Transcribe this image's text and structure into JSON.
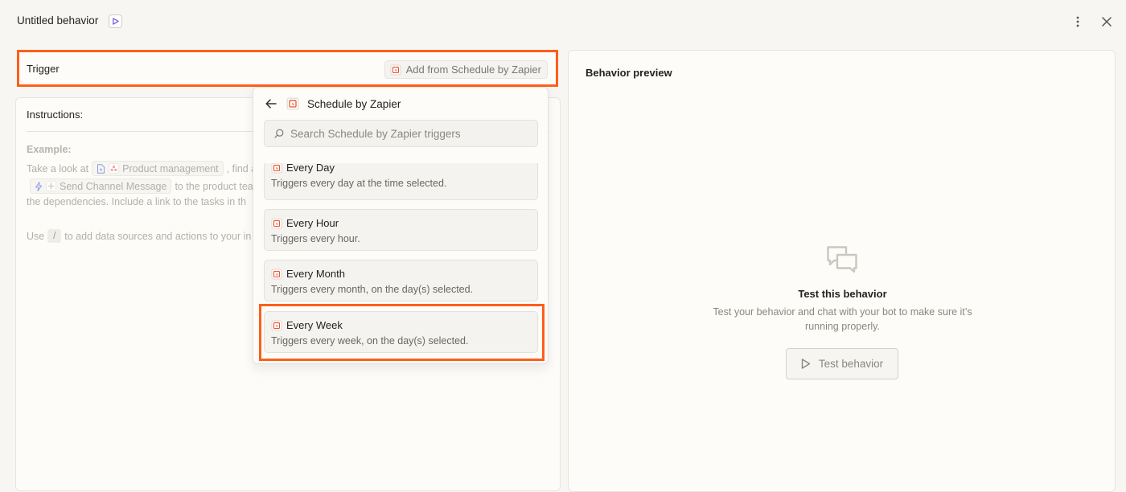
{
  "header": {
    "title": "Untitled behavior"
  },
  "trigger": {
    "label": "Trigger",
    "add_button_label": "Add from Schedule by Zapier"
  },
  "instructions": {
    "label": "Instructions:",
    "example_label": "Example:",
    "line1_prefix": "Take a look at",
    "chip_product": "Product management",
    "line1_suffix": ", find a",
    "chip_send": "Send Channel Message",
    "line2_suffix": "to the product tea",
    "line3": "the dependencies. Include a link to the tasks in th",
    "line4_prefix": "Use",
    "slash": "/",
    "line4_suffix": "to add data sources and actions to your in"
  },
  "dropdown": {
    "title": "Schedule by Zapier",
    "search_placeholder": "Search Schedule by Zapier triggers",
    "items": [
      {
        "name": "Every Day",
        "desc": "Triggers every day at the time selected."
      },
      {
        "name": "Every Hour",
        "desc": "Triggers every hour."
      },
      {
        "name": "Every Month",
        "desc": "Triggers every month, on the day(s) selected."
      },
      {
        "name": "Every Week",
        "desc": "Triggers every week, on the day(s) selected."
      }
    ]
  },
  "preview": {
    "title": "Behavior preview",
    "empty_title": "Test this behavior",
    "empty_desc": "Test your behavior and chat with your bot to make sure it’s running properly.",
    "test_button_label": "Test behavior"
  },
  "colors": {
    "highlight": "#ff5e1a",
    "schedule_brand": "#e8542a"
  },
  "icons": [
    "play-icon",
    "kebab-menu-icon",
    "close-icon",
    "schedule-icon",
    "back-arrow-icon",
    "search-icon",
    "document-icon",
    "asana-icon",
    "bolt-icon",
    "slack-icon",
    "chat-bubbles-icon"
  ]
}
